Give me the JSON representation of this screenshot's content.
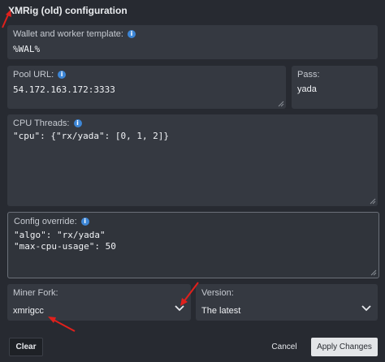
{
  "dialog": {
    "title": "XMRig (old) configuration"
  },
  "fields": {
    "wallet": {
      "label": "Wallet and worker template:",
      "value": "%WAL%"
    },
    "pool_url": {
      "label": "Pool URL:",
      "value": "54.172.163.172:3333"
    },
    "pass": {
      "label": "Pass:",
      "value": "yada"
    },
    "cpu_threads": {
      "label": "CPU Threads:",
      "value": "\"cpu\": {\"rx/yada\": [0, 1, 2]}"
    },
    "config_override": {
      "label": "Config override:",
      "line1": "\"algo\": \"rx/yada\"",
      "line2": "\"max-cpu-usage\": 50"
    },
    "miner_fork": {
      "label": "Miner Fork:",
      "value": "xmrigcc"
    },
    "version": {
      "label": "Version:",
      "value": "The latest"
    }
  },
  "buttons": {
    "clear": "Clear",
    "cancel": "Cancel",
    "apply": "Apply Changes"
  },
  "icons": {
    "info": "info-icon",
    "chevron": "chevron-down-icon",
    "annotation": "red-arrow-annotation"
  },
  "colors": {
    "background": "#272a31",
    "panel": "#353941",
    "info_accent": "#3d86d6",
    "annotation": "#e0201c",
    "apply_button": "#e3e5e8"
  }
}
